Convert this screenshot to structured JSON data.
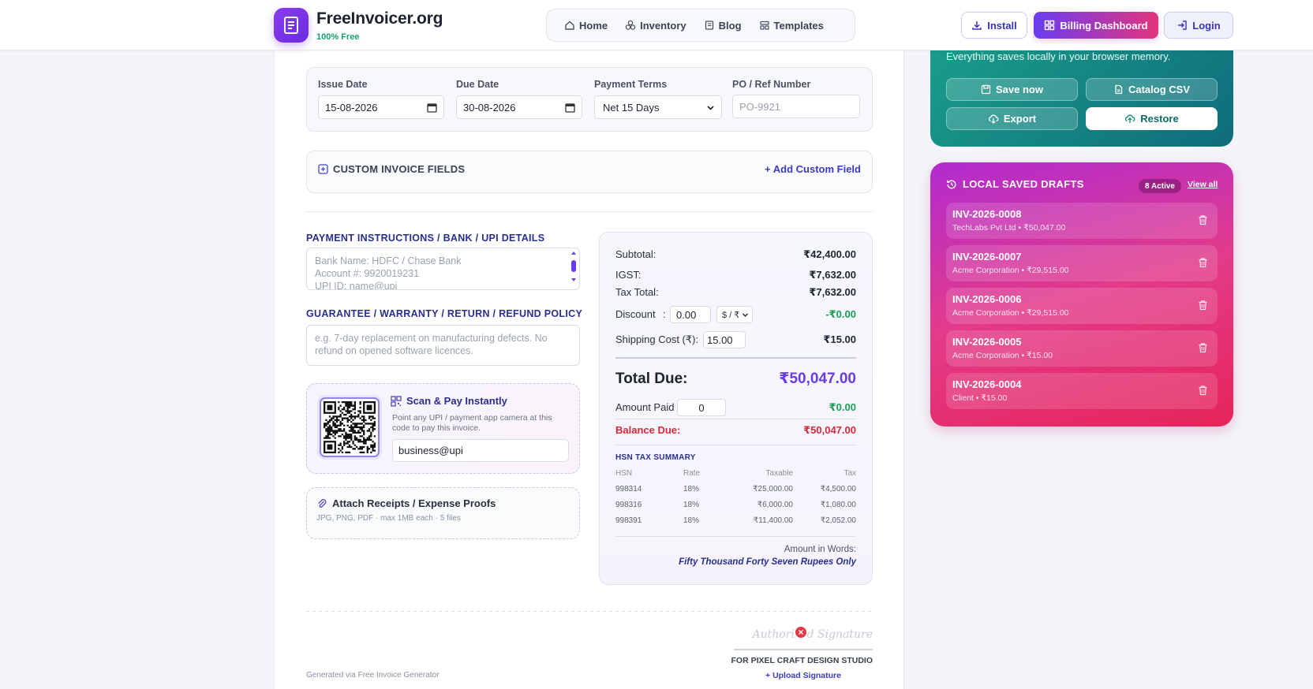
{
  "header": {
    "brand_name": "FreeInvoicer.org",
    "brand_sub": "100% Free",
    "nav": [
      {
        "label": "Home",
        "icon": "home-icon"
      },
      {
        "label": "Inventory",
        "icon": "boxes-icon"
      },
      {
        "label": "Blog",
        "icon": "book-icon"
      },
      {
        "label": "Templates",
        "icon": "layout-icon"
      }
    ],
    "install_label": "Install",
    "dashboard_label": "Billing Dashboard",
    "login_label": "Login"
  },
  "dates": {
    "issue_label": "Issue Date",
    "issue_value": "15-08-2026",
    "due_label": "Due Date",
    "due_value": "30-08-2026",
    "terms_label": "Payment Terms",
    "terms_value": "Net 15 Days",
    "po_label": "PO / Ref Number",
    "po_placeholder": "PO-9921"
  },
  "custom_fields": {
    "title": "CUSTOM INVOICE FIELDS",
    "add_label": "+ Add Custom Field"
  },
  "payment": {
    "heading": "PAYMENT INSTRUCTIONS / BANK / UPI DETAILS",
    "placeholder_lines": [
      "Bank Name: HDFC / Chase Bank",
      "Account #: 9920019231",
      "UPI ID: name@upi"
    ]
  },
  "policy": {
    "heading": "GUARANTEE / WARRANTY / RETURN / REFUND POLICY",
    "placeholder": "e.g. 7-day replacement on manufacturing defects. No refund on opened software licences."
  },
  "scan": {
    "title": "Scan & Pay Instantly",
    "desc": "Point any UPI / payment app camera at this code to pay this invoice.",
    "upi_value": "business@upi"
  },
  "attach": {
    "title": "Attach Receipts / Expense Proofs",
    "sub": "JPG, PNG, PDF · max 1MB each · 5 files"
  },
  "totals": {
    "subtotal_label": "Subtotal:",
    "subtotal_value": "₹42,400.00",
    "igst_label": "IGST:",
    "igst_value": "₹7,632.00",
    "tax_total_label": "Tax Total:",
    "tax_total_value": "₹7,632.00",
    "discount_label": "Discount",
    "discount_colon": ":",
    "discount_input": "0.00",
    "discount_unit": "$ / ₹",
    "discount_value": "-₹0.00",
    "shipping_label": "Shipping Cost (₹):",
    "shipping_input": "15.00",
    "shipping_value": "₹15.00",
    "total_due_label": "Total Due:",
    "total_due_value": "₹50,047.00",
    "amount_paid_label": "Amount Paid",
    "amount_paid_input": "0",
    "amount_paid_value": "₹0.00",
    "balance_label": "Balance Due:",
    "balance_value": "₹50,047.00",
    "hsn_heading": "HSN TAX SUMMARY",
    "hsn_columns": [
      "HSN",
      "Rate",
      "Taxable",
      "Tax"
    ],
    "hsn_rows": [
      [
        "998314",
        "18%",
        "₹25,000.00",
        "₹4,500.00"
      ],
      [
        "998316",
        "18%",
        "₹6,000.00",
        "₹1,080.00"
      ],
      [
        "998391",
        "18%",
        "₹11,400.00",
        "₹2,052.00"
      ]
    ],
    "words_label": "Amount in Words:",
    "words_value": "Fifty Thousand Forty Seven Rupees Only"
  },
  "signature": {
    "placeholder": "Authorized Signature",
    "remove": "×",
    "for_label": "FOR PIXEL CRAFT DESIGN STUDIO",
    "upload_label": "+ Upload Signature"
  },
  "footer": {
    "generated": "Generated via Free Invoice Generator"
  },
  "backup": {
    "text": "Everything saves locally in your browser memory.",
    "save_label": "Save now",
    "catalog_label": "Catalog CSV",
    "export_label": "Export",
    "restore_label": "Restore"
  },
  "drafts": {
    "title": "LOCAL SAVED DRAFTS",
    "badge": "8 Active",
    "view_all": "View all",
    "items": [
      {
        "id": "INV-2026-0008",
        "sub": "TechLabs Pvt Ltd • ₹50,047.00"
      },
      {
        "id": "INV-2026-0007",
        "sub": "Acme Corporation • ₹29,515.00"
      },
      {
        "id": "INV-2026-0006",
        "sub": "Acme Corporation • ₹29,515.00"
      },
      {
        "id": "INV-2026-0005",
        "sub": "Acme Corporation • ₹15.00"
      },
      {
        "id": "INV-2026-0004",
        "sub": "Client • ₹15.00"
      }
    ]
  },
  "colors": {
    "accent": "#6a3cf0",
    "brand_green": "#14a06a",
    "teal_panel": "#1a9f8a",
    "drafts_gradient_start": "#b12bd0",
    "drafts_gradient_end": "#e6245a",
    "positive": "#18a055",
    "negative": "#d42a3a"
  }
}
